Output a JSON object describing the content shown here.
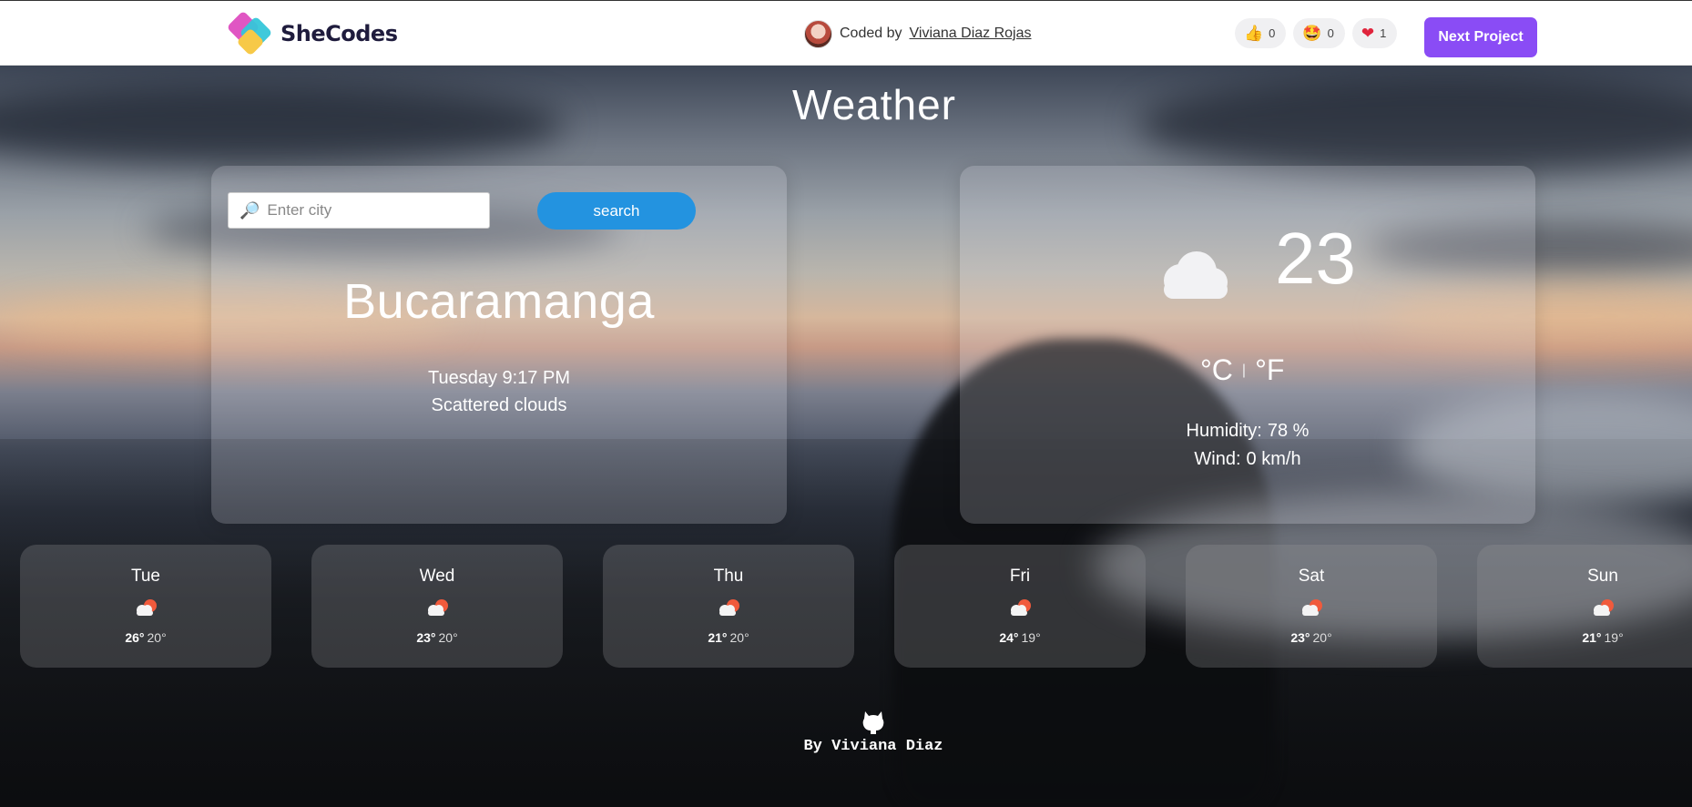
{
  "topbar": {
    "brand_name": "SheCodes",
    "credit_prefix": "Coded by",
    "credit_author": "Viviana Diaz Rojas",
    "reactions": [
      {
        "icon": "thumbs-up-icon",
        "glyph": "👍",
        "count": "0"
      },
      {
        "icon": "star-struck-icon",
        "glyph": "🤩",
        "count": "0"
      },
      {
        "icon": "heart-icon",
        "glyph": "❤",
        "count": "1"
      }
    ],
    "next_project_label": "Next Project",
    "accent_color": "#8a4cf5"
  },
  "app": {
    "title": "Weather",
    "search": {
      "placeholder": "Enter city",
      "value": "",
      "button_label": "search"
    },
    "city": "Bucaramanga",
    "datetime": "Tuesday 9:17 PM",
    "description": "Scattered clouds",
    "current": {
      "icon": "cloud-icon",
      "temperature": "23",
      "unit_celsius": "°C",
      "unit_separator": "|",
      "unit_fahrenheit": "°F",
      "humidity_label": "Humidity:",
      "humidity_value": "78 %",
      "wind_label": "Wind:",
      "wind_value": "0 km/h"
    },
    "forecast": [
      {
        "day": "Tue",
        "icon": "partly-cloudy-icon",
        "max": "26°",
        "min": "20°"
      },
      {
        "day": "Wed",
        "icon": "partly-cloudy-icon",
        "max": "23°",
        "min": "20°"
      },
      {
        "day": "Thu",
        "icon": "partly-cloudy-icon",
        "max": "21°",
        "min": "20°"
      },
      {
        "day": "Fri",
        "icon": "partly-cloudy-icon",
        "max": "24°",
        "min": "19°"
      },
      {
        "day": "Sat",
        "icon": "partly-cloudy-icon",
        "max": "23°",
        "min": "20°"
      },
      {
        "day": "Sun",
        "icon": "partly-cloudy-icon",
        "max": "21°",
        "min": "19°"
      }
    ]
  },
  "footer": {
    "icon": "github-icon",
    "text": "By Viviana Diaz"
  }
}
